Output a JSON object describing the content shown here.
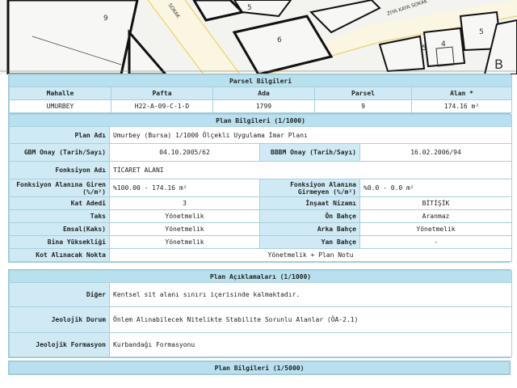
{
  "map": {
    "labels": [
      "9",
      "5",
      "6",
      "5",
      "4",
      "5",
      "SOKAK",
      "ZIYA KAYA SOKAK",
      "B"
    ]
  },
  "parsel": {
    "title": "Parsel Bilgileri",
    "headers": [
      "Mahalle",
      "Pafta",
      "Ada",
      "Parsel",
      "Alan *"
    ],
    "values": [
      "UMURBEY",
      "H22-A-09-C-1-D",
      "1799",
      "9",
      "174.16 m²"
    ]
  },
  "plan": {
    "title": "Plan Bilgileri (1/1000)",
    "plan_adi_label": "Plan Adı",
    "plan_adi": "Umurbey (Bursa) 1/1000 Ölçekli Uygulama İmar Planı",
    "gbm_label": "GBM Onay (Tarih/Sayı)",
    "gbm_value": "04.10.2005/62",
    "bbbm_label": "BBBM Onay (Tarih/Sayı)",
    "bbbm_value": "16.02.2006/94",
    "fonksiyon_adi_label": "Fonksiyon Adı",
    "fonksiyon_adi": "TİCARET ALANI",
    "fonk_giren_label": "Fonksiyon Alanına Giren (%/m²)",
    "fonk_giren": "%100.00 - 174.16 m²",
    "fonk_girmeyen_label": "Fonksiyon Alanına Girmeyen (%/m²)",
    "fonk_girmeyen": "%0.0 - 0.0 m²",
    "kat_adedi_label": "Kat Adedi",
    "kat_adedi": "3",
    "insaat_nizami_label": "İnşaat Nizamı",
    "insaat_nizami": "BİTİŞİK",
    "taks_label": "Taks",
    "taks": "Yönetmelik",
    "on_bahce_label": "Ön Bahçe",
    "on_bahce": "Aranmaz",
    "emsal_label": "Emsal(Kaks)",
    "emsal": "Yönetmelik",
    "arka_bahce_label": "Arka Bahçe",
    "arka_bahce": "Yönetmelik",
    "bina_yuk_label": "Bina Yüksekliği",
    "bina_yuk": "Yönetmelik",
    "yan_bahce_label": "Yan Bahçe",
    "yan_bahce": "-",
    "kot_label": "Kot Alınacak Nokta",
    "kot": "Yönetmelik + Plan Notu"
  },
  "aciklama": {
    "title": "Plan Açıklamaları (1/1000)",
    "diger_label": "Diğer",
    "diger": "Kentsel sit alanı sınırı içerisinde kalmaktadır.",
    "jeo_durum_label": "Jeolojik Durum",
    "jeo_durum": "Önlem Alınabilecek Nitelikte Stabilite Sorunlu Alanlar (ÖA-2.1)",
    "jeo_form_label": "Jeolojik Formasyon",
    "jeo_form": "Kurbandağı Formasyonu"
  },
  "plan5000": {
    "title": "Plan Bilgileri (1/5000)"
  }
}
